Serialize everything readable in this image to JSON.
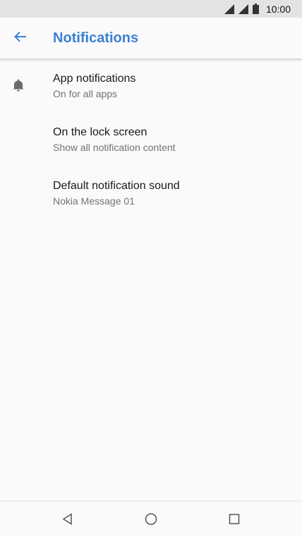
{
  "status_bar": {
    "time": "10:00",
    "icons": [
      "signal-icon",
      "signal-icon",
      "battery-icon"
    ]
  },
  "app_bar": {
    "back_icon": "arrow-left-icon",
    "title": "Notifications",
    "accent_color": "#3c80d6"
  },
  "settings": [
    {
      "icon": "bell-icon",
      "title": "App notifications",
      "summary": "On for all apps"
    },
    {
      "icon": "",
      "title": "On the lock screen",
      "summary": "Show all notification content"
    },
    {
      "icon": "",
      "title": "Default notification sound",
      "summary": "Nokia Message 01"
    }
  ],
  "nav_bar": {
    "buttons": [
      "back-triangle-icon",
      "home-circle-icon",
      "recents-square-icon"
    ]
  }
}
